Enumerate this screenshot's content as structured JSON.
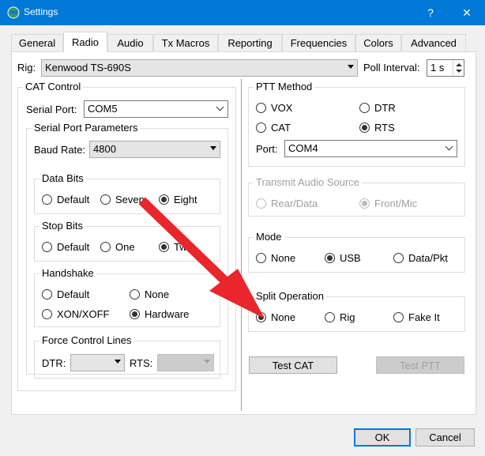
{
  "window": {
    "title": "Settings",
    "help_glyph": "?",
    "close_glyph": "✕"
  },
  "tabs": [
    {
      "label": "General"
    },
    {
      "label": "Radio"
    },
    {
      "label": "Audio"
    },
    {
      "label": "Tx Macros"
    },
    {
      "label": "Reporting"
    },
    {
      "label": "Frequencies"
    },
    {
      "label": "Colors"
    },
    {
      "label": "Advanced"
    }
  ],
  "active_tab": "Radio",
  "rig": {
    "label": "Rig:",
    "value": "Kenwood TS-690S"
  },
  "poll": {
    "label": "Poll Interval:",
    "value": "1 s"
  },
  "cat": {
    "title": "CAT Control",
    "serial_port_label": "Serial Port:",
    "serial_port_value": "COM5",
    "params_title": "Serial Port Parameters",
    "baud_label": "Baud Rate:",
    "baud_value": "4800",
    "data_bits": {
      "title": "Data Bits",
      "options": [
        "Default",
        "Seven",
        "Eight"
      ],
      "selected": "Eight"
    },
    "stop_bits": {
      "title": "Stop Bits",
      "options": [
        "Default",
        "One",
        "Two"
      ],
      "selected": "Two"
    },
    "handshake": {
      "title": "Handshake",
      "options": [
        "Default",
        "None",
        "XON/XOFF",
        "Hardware"
      ],
      "selected": "Hardware"
    },
    "force": {
      "title": "Force Control Lines",
      "dtr_label": "DTR:",
      "rts_label": "RTS:",
      "dtr_value": "",
      "rts_value": ""
    }
  },
  "ptt": {
    "title": "PTT Method",
    "options": [
      "VOX",
      "DTR",
      "CAT",
      "RTS"
    ],
    "selected": "RTS",
    "port_label": "Port:",
    "port_value": "COM4"
  },
  "audio_source": {
    "title": "Transmit Audio Source",
    "options": [
      "Rear/Data",
      "Front/Mic"
    ],
    "selected": "Front/Mic"
  },
  "mode": {
    "title": "Mode",
    "options": [
      "None",
      "USB",
      "Data/Pkt"
    ],
    "selected": "USB"
  },
  "split": {
    "title": "Split Operation",
    "options": [
      "None",
      "Rig",
      "Fake It"
    ],
    "selected": "None"
  },
  "buttons": {
    "test_cat": "Test CAT",
    "test_ptt": "Test PTT",
    "ok": "OK",
    "cancel": "Cancel"
  },
  "colors": {
    "titlebar": "#0078d7",
    "annotation_arrow": "#e8262b"
  }
}
